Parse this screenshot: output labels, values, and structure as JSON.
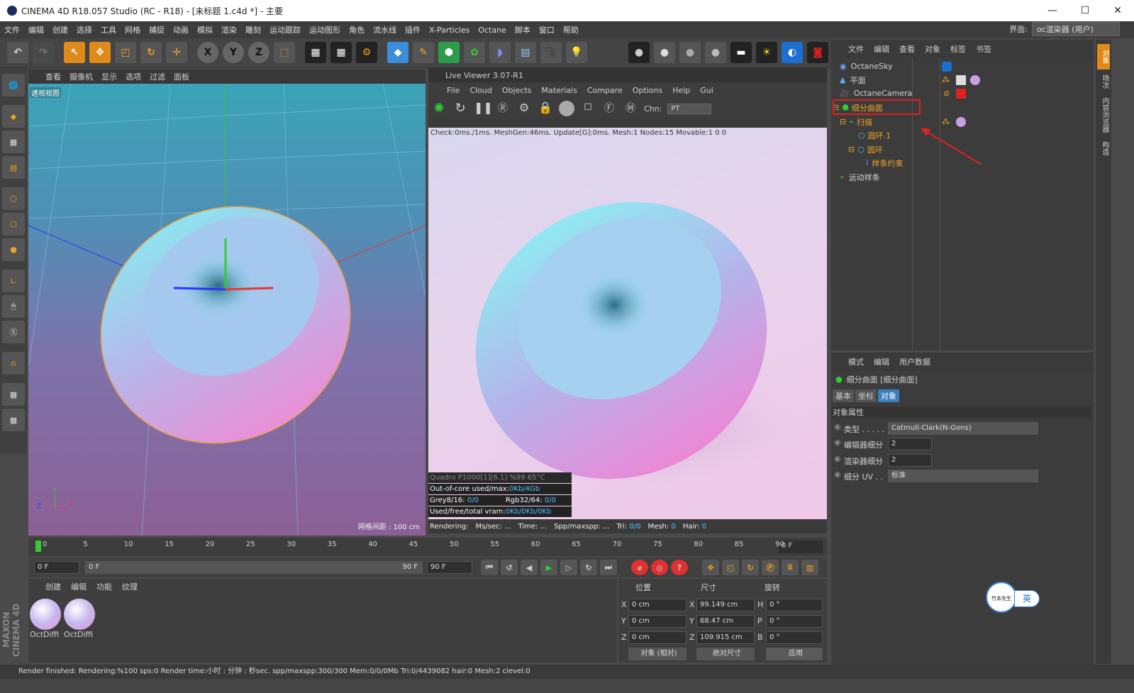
{
  "window": {
    "title": "CINEMA 4D R18.057 Studio (RC - R18) - [未标题 1.c4d *] - 主要",
    "controls": [
      "—",
      "☐",
      "✕"
    ]
  },
  "menubar": {
    "items": [
      "文件",
      "编辑",
      "创建",
      "选择",
      "工具",
      "网格",
      "捕捉",
      "动画",
      "模拟",
      "渲染",
      "雕刻",
      "运动跟踪",
      "运动图形",
      "角色",
      "流水线",
      "插件",
      "X-Particles",
      "Octane",
      "脚本",
      "窗口",
      "帮助"
    ],
    "interface_label": "界面:",
    "interface_value": "oc渲染器 (用户)"
  },
  "toolbar": {
    "axis": [
      "X",
      "Y",
      "Z"
    ]
  },
  "viewport": {
    "menu": [
      "查看",
      "摄像机",
      "显示",
      "选项",
      "过滤",
      "面板"
    ],
    "label": "透视视图",
    "grid": "网格间距 : 100 cm"
  },
  "liveviewer": {
    "title": "Live Viewer 3.07-R1",
    "menu": [
      "File",
      "Cloud",
      "Objects",
      "Materials",
      "Compare",
      "Options",
      "Help",
      "Gui"
    ],
    "chn_label": "Chn:",
    "chn_value": "PT",
    "check": "Check:0ms./1ms. MeshGen:46ms. Update[G]:0ms. Mesh:1 Nodes:15 Movable:1  0 0",
    "gpu": "Quadro P1000[1][6.1]        %99       65°C",
    "ooc_label": "Out-of-core used/max:",
    "ooc_value": "0Kb/4Gb",
    "grey_label": "Grey8/16:",
    "grey_value": "0/0",
    "rgb_label": "Rgb32/64:",
    "rgb_value": "0/0",
    "vram_label": "Used/free/total vram:",
    "vram_value": "0Kb/0Kb/0Kb",
    "status": {
      "rendering": "Rendering:",
      "mssec": "Ms/sec: ...",
      "time": "Time: ...",
      "spp": "Spp/maxspp: ...",
      "tri_label": "Tri:",
      "tri": "0/0",
      "mesh_label": "Mesh:",
      "mesh": "0",
      "hair_label": "Hair:",
      "hair": "0"
    }
  },
  "timeline": {
    "ticks": [
      "0",
      "5",
      "10",
      "15",
      "20",
      "25",
      "30",
      "35",
      "40",
      "45",
      "50",
      "55",
      "60",
      "65",
      "70",
      "75",
      "80",
      "85",
      "90"
    ],
    "frame_right": "0 F",
    "start": "0 F",
    "slider_left": "0 F",
    "slider_right": "90 F",
    "end": "90 F"
  },
  "materials": {
    "menu": [
      "创建",
      "编辑",
      "功能",
      "纹理"
    ],
    "items": [
      "OctDiffi",
      "OctDiffi"
    ]
  },
  "coords": {
    "headers": [
      "位置",
      "尺寸",
      "旋转"
    ],
    "pos": [
      {
        "axis": "X",
        "value": "0 cm"
      },
      {
        "axis": "Y",
        "value": "0 cm"
      },
      {
        "axis": "Z",
        "value": "0 cm"
      }
    ],
    "size": [
      {
        "axis": "X",
        "value": "99.149 cm"
      },
      {
        "axis": "Y",
        "value": "68.47 cm"
      },
      {
        "axis": "Z",
        "value": "109.915 cm"
      }
    ],
    "rot": [
      {
        "axis": "H",
        "value": "0 °"
      },
      {
        "axis": "P",
        "value": "0 °"
      },
      {
        "axis": "B",
        "value": "0 °"
      }
    ],
    "mode1": "对象 (相对)",
    "mode2": "绝对尺寸",
    "apply": "应用"
  },
  "objects": {
    "menu": [
      "文件",
      "编辑",
      "查看",
      "对象",
      "标签",
      "书签"
    ],
    "rows": [
      "OctaneSky",
      "平面",
      "OctaneCamera",
      "细分曲面",
      "扫描",
      "圆环.1",
      "圆环",
      "样条约束",
      "运动样条"
    ]
  },
  "attributes": {
    "menu": [
      "模式",
      "编辑",
      "用户数据"
    ],
    "title": "细分曲面 [细分曲面]",
    "tabs": [
      "基本",
      "坐标",
      "对象"
    ],
    "section": "对象属性",
    "type_label": "类型 . . . . .",
    "type_value": "Catmull-Clark(N-Gons)",
    "editor_label": "编辑器细分",
    "editor_value": "2",
    "render_label": "渲染器细分",
    "render_value": "2",
    "uv_label": "细分 UV . .",
    "uv_value": "标准"
  },
  "rightstrip": [
    "对象",
    "场次",
    "内容浏览器",
    "构造"
  ],
  "statusbar": "Render finished: Rendering:%100 sps:0 Render time:小时 : 分钟 : 秒sec. spp/maxspp:300/300 Mem:0/0/0Mb Tri:0/4439082 hair:0 Mesh:2 clevel:0",
  "brand": "MAXON CINEMA 4D",
  "ime": {
    "label": "英",
    "logo": "竹本先生"
  },
  "colors": {
    "accent": "#4fc3ff",
    "highlight": "#e0a020",
    "red_marker": "#e02020"
  }
}
